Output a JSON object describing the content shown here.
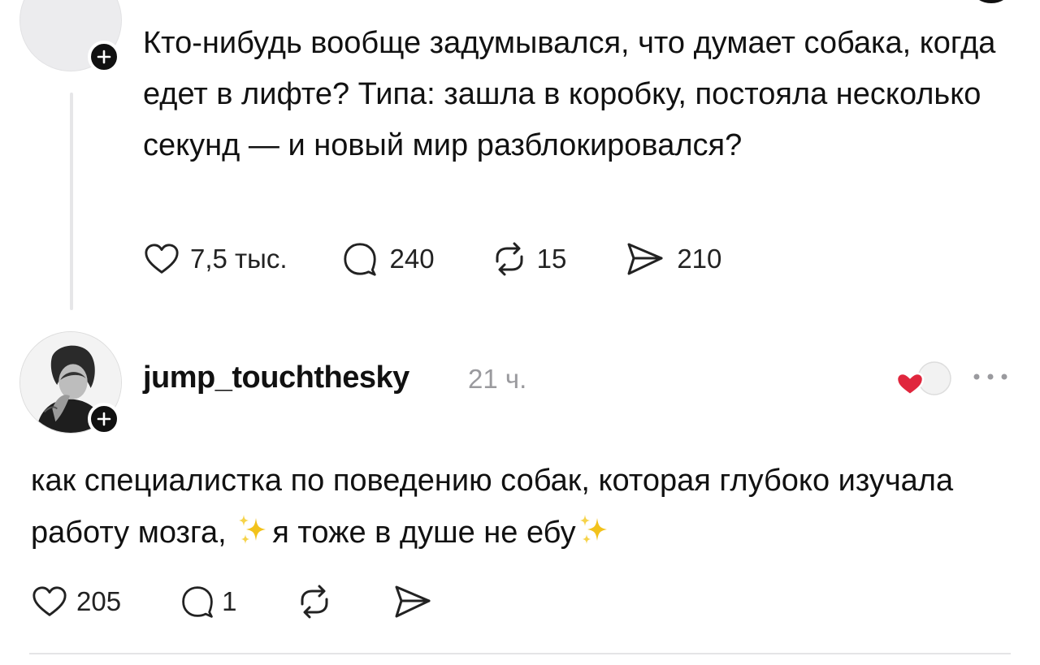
{
  "post1": {
    "text": "Кто-нибудь вообще задумывался, что думает собака, когда едет в лифте? Типа: зашла в коробку, постояла несколько секунд — и новый мир разблокировался?",
    "actions": {
      "likes": "7,5 тыс.",
      "comments": "240",
      "reposts": "15",
      "shares": "210"
    }
  },
  "post2": {
    "username": "jump_touchthesky",
    "timestamp": "21 ч.",
    "text_part1": "как специалистка по поведению собак, которая глубоко изучала работу мозга, ",
    "text_part2": "я тоже в душе не ебу",
    "actions": {
      "likes": "205",
      "comments": "1"
    }
  },
  "colors": {
    "heart_red": "#e0263d",
    "sparkle_gold": "#f2c21b",
    "muted": "#9a9a9e"
  },
  "icons": [
    "plus-icon",
    "heart-icon",
    "comment-icon",
    "repost-icon",
    "share-icon",
    "more-icon",
    "sparkles-icon"
  ]
}
